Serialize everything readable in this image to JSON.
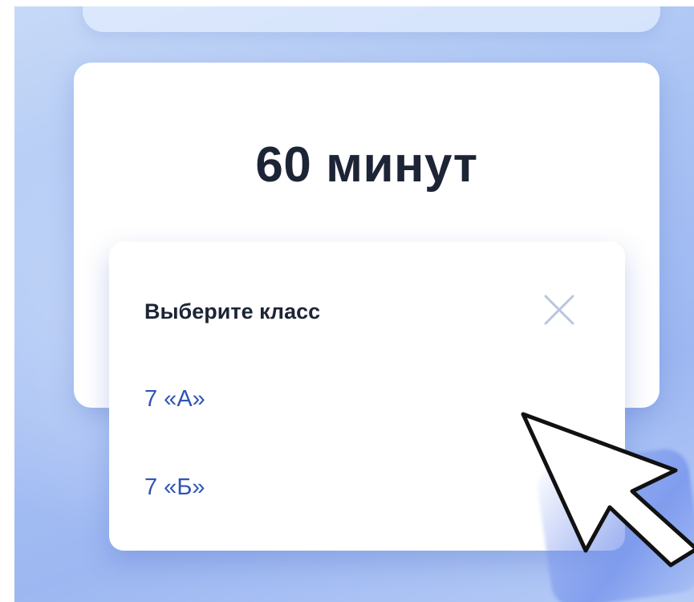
{
  "card": {
    "duration_text": "60 минут"
  },
  "class_popup": {
    "title": "Выберите класс",
    "options": [
      {
        "label": "7 «А»"
      },
      {
        "label": "7 «Б»"
      }
    ]
  },
  "colors": {
    "background_accent": "#a9c3f4",
    "option_text": "#2f54b8",
    "title_text": "#1c2435"
  },
  "icons": {
    "close": "close-icon",
    "pointer": "mouse-pointer-icon"
  }
}
